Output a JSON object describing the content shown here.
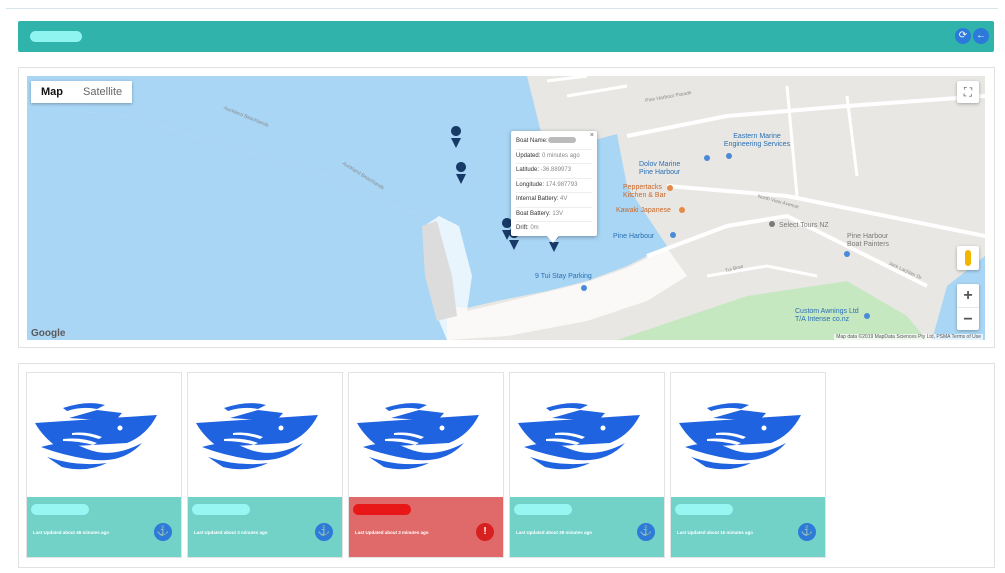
{
  "header": {
    "refresh_icon": "refresh-icon",
    "back_icon": "back-arrow-icon",
    "accent": "#2fb3aa"
  },
  "map": {
    "map_type": {
      "map": "Map",
      "satellite": "Satellite",
      "selected": "Map"
    },
    "google": "Google",
    "attribution": "Map data ©2019 MapData Sciences Pty Ltd, PSMA   Terms of Use",
    "zoom_in": "+",
    "zoom_out": "−",
    "fullscreen_icon": "fullscreen-icon",
    "labels": {
      "auckland_1": "Auckland Beachlands",
      "auckland_2": "Auckland Beachlands",
      "pine_harbour_parade": "Pine Harbour Parade",
      "eastern_marine": "Eastern Marine\nEngineering Services",
      "dolov_marine": "Dolov Marine\nPine Harbour",
      "peppertacks": "Peppertacks\nKitchen & Bar",
      "kawaki": "Kawaki Japanese",
      "pine_harbour": "Pine Harbour",
      "select_tours": "Select Tours NZ",
      "pine_harbour_boat_painters": "Pine Harbour\nBoat Painters",
      "tu_stay_parking": "9 Tui Stay Parking",
      "custom_awnings": "Custom Awnings Ltd\nT/A Intense co.nz",
      "north_view_ave": "North View Avenue",
      "jack_lachlan_dr": "Jack Lachlan Dr",
      "tui_brae": "Tui Brae"
    },
    "popup": {
      "boat_name_label": "Boat Name:",
      "updated_label": "Updated: ",
      "updated_value": "0 minutes ago",
      "latitude_label": "Latitude: ",
      "latitude_value": "-36.889973",
      "longitude_label": "Longitude: ",
      "longitude_value": "174.987793",
      "internal_battery_label": "Internal Battery: ",
      "internal_battery_value": "4V",
      "boat_battery_label": "Boat Battery: ",
      "boat_battery_value": "13V",
      "drift_label": "Drift: ",
      "drift_value": "0m",
      "close": "×"
    }
  },
  "boats": [
    {
      "updated": "Last Updated about 46 minutes ago",
      "status": "ok",
      "action_icon": "anchor-icon",
      "action_label": "⚓"
    },
    {
      "updated": "Last Updated about 3 minutes ago",
      "status": "ok",
      "action_icon": "anchor-icon",
      "action_label": "⚓"
    },
    {
      "updated": "Last Updated about 3 minutes ago",
      "status": "alert",
      "action_icon": "alert-icon",
      "action_label": "!"
    },
    {
      "updated": "Last Updated about 28 minutes ago",
      "status": "ok",
      "action_icon": "anchor-icon",
      "action_label": "⚓"
    },
    {
      "updated": "Last Updated about 15 minutes ago",
      "status": "ok",
      "action_icon": "anchor-icon",
      "action_label": "⚓"
    }
  ],
  "colors": {
    "water": "#a9d6f5",
    "boat_blue": "#1f63e0",
    "card_ok": "#72d2c8",
    "card_alert": "#e06a6a",
    "marker": "#183a66"
  }
}
